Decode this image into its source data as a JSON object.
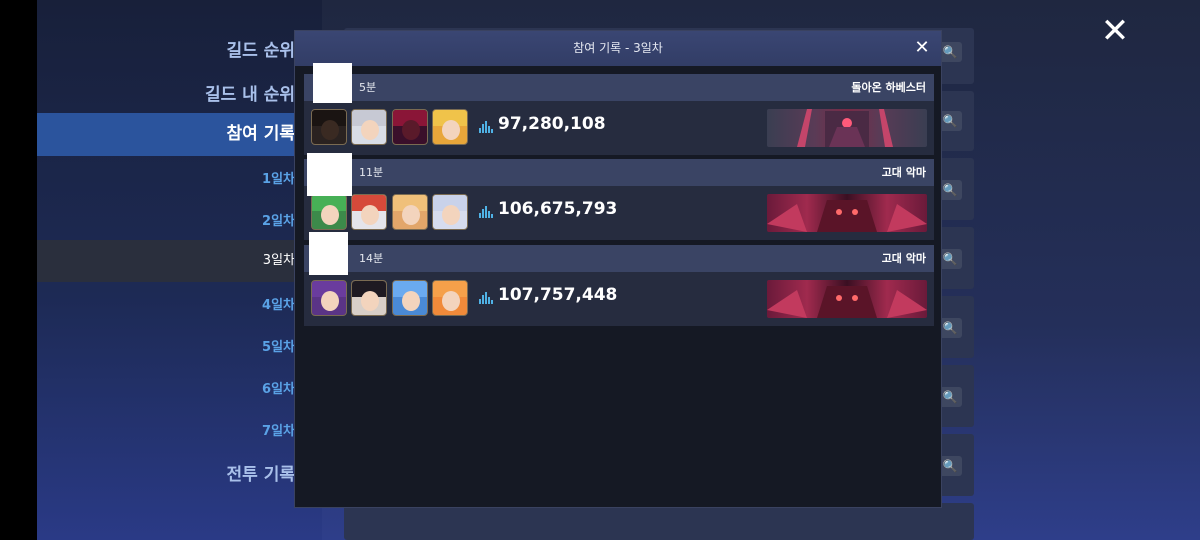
{
  "sidebar": {
    "items": [
      {
        "label": "길드 순위"
      },
      {
        "label": "길드 내 순위"
      },
      {
        "label": "참여 기록"
      },
      {
        "label": "1일차"
      },
      {
        "label": "2일차"
      },
      {
        "label": "3일차"
      },
      {
        "label": "4일차"
      },
      {
        "label": "5일차"
      },
      {
        "label": "6일차"
      },
      {
        "label": "7일차"
      },
      {
        "label": "전투 기록"
      }
    ]
  },
  "close_main": "✕",
  "modal": {
    "title": "참여 기록 - 3일차",
    "close": "✕",
    "records": [
      {
        "time": "5분",
        "boss": "돌아온 하베스터",
        "score": "97,280,108"
      },
      {
        "time": "11분",
        "boss": "고대 악마",
        "score": "106,675,793"
      },
      {
        "time": "14분",
        "boss": "고대 악마",
        "score": "107,757,448"
      }
    ]
  },
  "colors": {
    "modal_header": "#3a4673",
    "record_head": "#3a4464",
    "record_body": "#262c3f",
    "score_icon": "#4fb2e6",
    "sidebar_active": "#2b549d"
  }
}
